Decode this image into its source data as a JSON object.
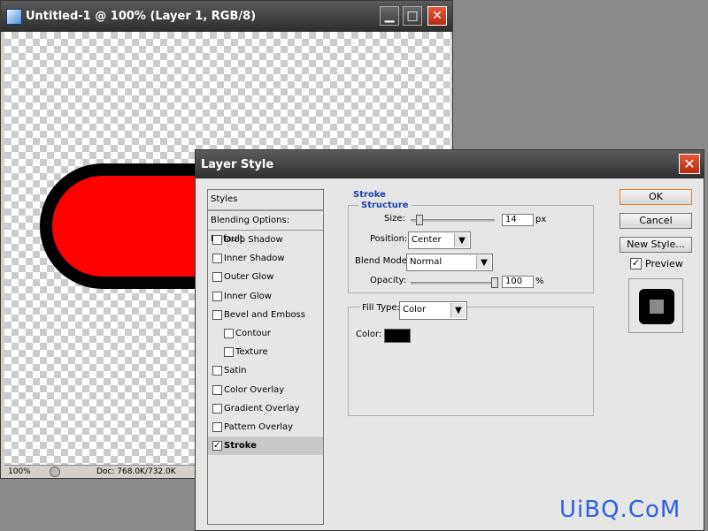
{
  "doc_window": {
    "title": "Untitled-1 @ 100% (Layer 1, RGB/8)",
    "min_glyph": "▁",
    "max_glyph": "□",
    "close_glyph": "✕",
    "status": {
      "zoom": "100%",
      "doc_size": "Doc: 768.0K/732.0K"
    }
  },
  "dialog": {
    "title": "Layer Style",
    "close_glyph": "✕",
    "styles_header": "Styles",
    "blending_header": "Blending Options: Default",
    "style_items": [
      {
        "label": "Drop Shadow",
        "checked": false,
        "sub": false
      },
      {
        "label": "Inner Shadow",
        "checked": false,
        "sub": false
      },
      {
        "label": "Outer Glow",
        "checked": false,
        "sub": false
      },
      {
        "label": "Inner Glow",
        "checked": false,
        "sub": false
      },
      {
        "label": "Bevel and Emboss",
        "checked": false,
        "sub": false
      },
      {
        "label": "Contour",
        "checked": false,
        "sub": true
      },
      {
        "label": "Texture",
        "checked": false,
        "sub": true
      },
      {
        "label": "Satin",
        "checked": false,
        "sub": false
      },
      {
        "label": "Color Overlay",
        "checked": false,
        "sub": false
      },
      {
        "label": "Gradient Overlay",
        "checked": false,
        "sub": false
      },
      {
        "label": "Pattern Overlay",
        "checked": false,
        "sub": false
      },
      {
        "label": "Stroke",
        "checked": true,
        "sub": false,
        "selected": true
      }
    ],
    "stroke": {
      "section_title": "Stroke",
      "structure_title": "Structure",
      "size_label": "Size:",
      "size_value": "14",
      "size_unit": "px",
      "size_fraction": 0.07,
      "position_label": "Position:",
      "position_value": "Center",
      "blend_label": "Blend Mode:",
      "blend_value": "Normal",
      "opacity_label": "Opacity:",
      "opacity_value": "100",
      "opacity_unit": "%",
      "opacity_fraction": 1.0,
      "fill_type_label": "Fill Type:",
      "fill_type_value": "Color",
      "color_label": "Color:",
      "color_value": "#000000"
    },
    "buttons": {
      "ok": "OK",
      "cancel": "Cancel",
      "new_style": "New Style..."
    },
    "preview_label": "Preview",
    "preview_checked": true
  },
  "watermark": "UiBQ.CoM",
  "colors": {
    "fill": "#ff0000",
    "stroke": "#000000",
    "accent_blue": "#1f3fa8"
  }
}
